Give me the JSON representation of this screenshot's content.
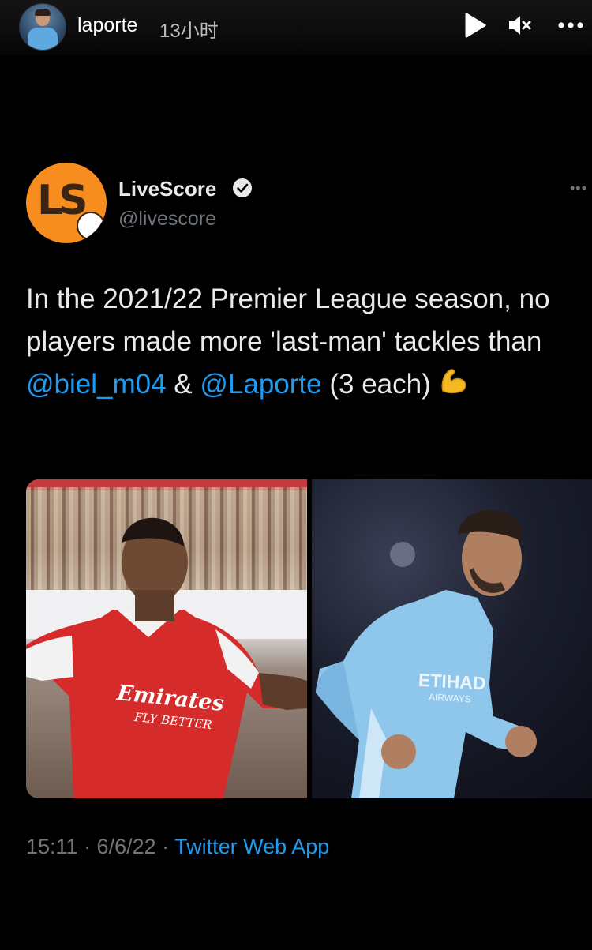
{
  "story": {
    "username": "laporte",
    "time_ago": "13小时"
  },
  "icons": {
    "play": "play-icon",
    "mute": "mute-icon",
    "more": "more-icon"
  },
  "tweet": {
    "account_name": "LiveScore",
    "handle": "@livescore",
    "text_before": "In the 2021/22 Premier League season, no players made more 'last-man' tackles than ",
    "mention1": "@biel_m04",
    "text_between": " & ",
    "mention2": "@Laporte",
    "text_after": " (3 each) ",
    "emoji": "💪",
    "timestamp": "15:11 · 6/6/22 · ",
    "source": "Twitter Web App"
  },
  "media": {
    "left_shirt_text": "Emirates",
    "left_shirt_subtext": "FLY BETTER",
    "right_shirt_text": "ETIHAD",
    "right_shirt_subtext": "AIRWAYS"
  },
  "colors": {
    "background": "#000000",
    "link": "#1d9bf0",
    "muted": "#71767b",
    "logo_orange": "#f78c1f"
  }
}
